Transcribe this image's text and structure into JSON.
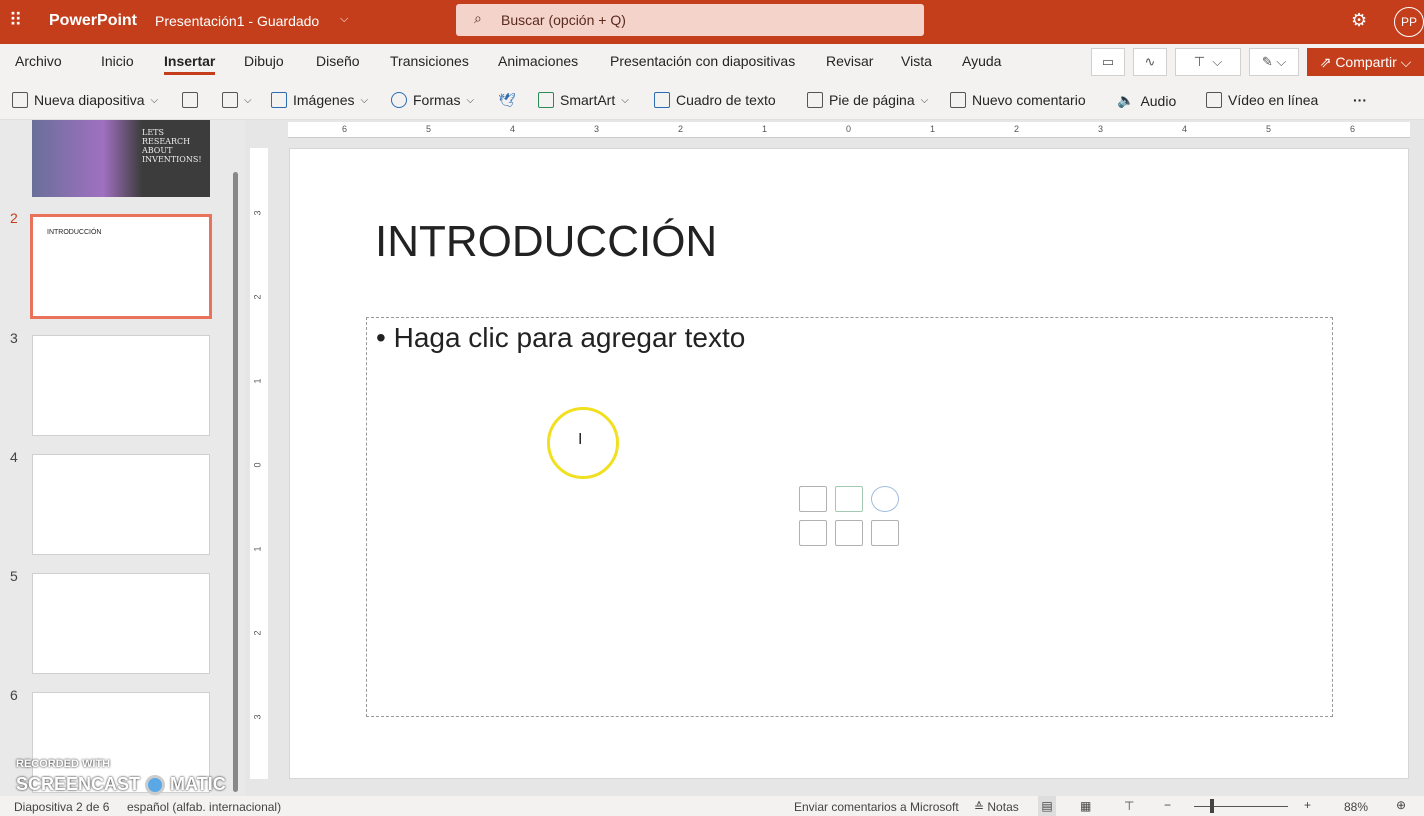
{
  "topbar": {
    "app": "PowerPoint",
    "doc": "Presentación1 - Guardado",
    "search": "Buscar (opción + Q)",
    "avatar": "PP"
  },
  "tabs": [
    "Archivo",
    "Inicio",
    "Insertar",
    "Dibujo",
    "Diseño",
    "Transiciones",
    "Animaciones",
    "Presentación con diapositivas",
    "Revisar",
    "Vista",
    "Ayuda"
  ],
  "share": "Compartir",
  "ribbon": {
    "new_slide": "Nueva diapositiva",
    "images": "Imágenes",
    "shapes": "Formas",
    "smartart": "SmartArt",
    "textbox": "Cuadro de texto",
    "footer": "Pie de página",
    "comment": "Nuevo comentario",
    "audio": "Audio",
    "video": "Vídeo en línea",
    "more": "···"
  },
  "thumbs": {
    "slide1_text": "LETS RESEARCH ABOUT INVENTIONS!",
    "slide2_title": "INTRODUCCIÓN",
    "numbers": [
      "2",
      "3",
      "4",
      "5",
      "6"
    ]
  },
  "ruler": {
    "h": [
      "6",
      "5",
      "4",
      "3",
      "2",
      "1",
      "0",
      "1",
      "2",
      "3",
      "4",
      "5",
      "6"
    ],
    "v": [
      "3",
      "2",
      "1",
      "0",
      "1",
      "2",
      "3"
    ]
  },
  "slide": {
    "title": "INTRODUCCIÓN",
    "placeholder": "Haga clic para agregar texto"
  },
  "watermark": {
    "line1": "RECORDED WITH",
    "line2": "SCREENCAST",
    "line3": "MATIC"
  },
  "status": {
    "slide": "Diapositiva 2 de 6",
    "lang": "español (alfab. internacional)",
    "feedback": "Enviar comentarios a Microsoft",
    "notes": "Notas",
    "zoom": "88%"
  },
  "colors": {
    "brand": "#c43e1c",
    "selected": "#e8735a"
  }
}
